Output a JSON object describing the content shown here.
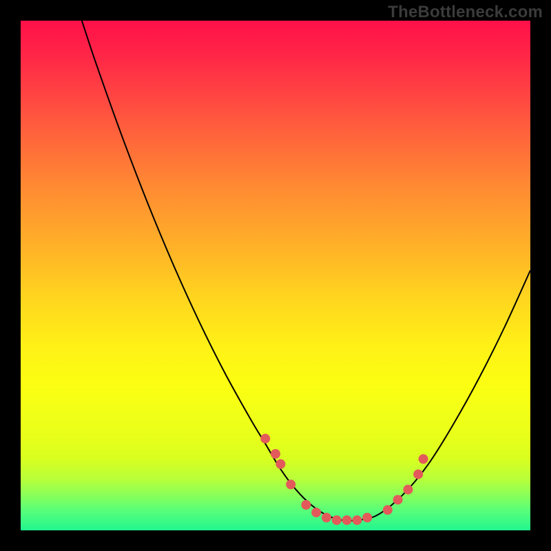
{
  "watermark": "TheBottleneck.com",
  "colors": {
    "background": "#000000",
    "marker": "#e35a5a",
    "curve": "#000000"
  },
  "chart_data": {
    "type": "line",
    "title": "",
    "xlabel": "",
    "ylabel": "",
    "xlim": [
      0,
      100
    ],
    "ylim": [
      0,
      100
    ],
    "grid": false,
    "legend": false,
    "annotations": [],
    "series": [
      {
        "name": "curve",
        "x": [
          12,
          15,
          20,
          25,
          30,
          35,
          40,
          45,
          48,
          51,
          54,
          57,
          60,
          63,
          66,
          70,
          75,
          80,
          85,
          90,
          95,
          100
        ],
        "y": [
          100,
          91,
          77,
          64,
          52,
          41,
          31,
          22,
          17,
          12,
          8,
          5,
          3,
          2,
          2,
          3,
          7,
          13,
          21,
          30,
          40,
          51
        ]
      }
    ],
    "markers": {
      "name": "highlighted-points",
      "x": [
        48,
        50,
        51,
        53,
        56,
        58,
        60,
        62,
        64,
        66,
        68,
        72,
        74,
        76,
        78,
        79
      ],
      "y": [
        18,
        15,
        13,
        9,
        5,
        3.5,
        2.5,
        2,
        2,
        2,
        2.5,
        4,
        6,
        8,
        11,
        14
      ]
    }
  }
}
